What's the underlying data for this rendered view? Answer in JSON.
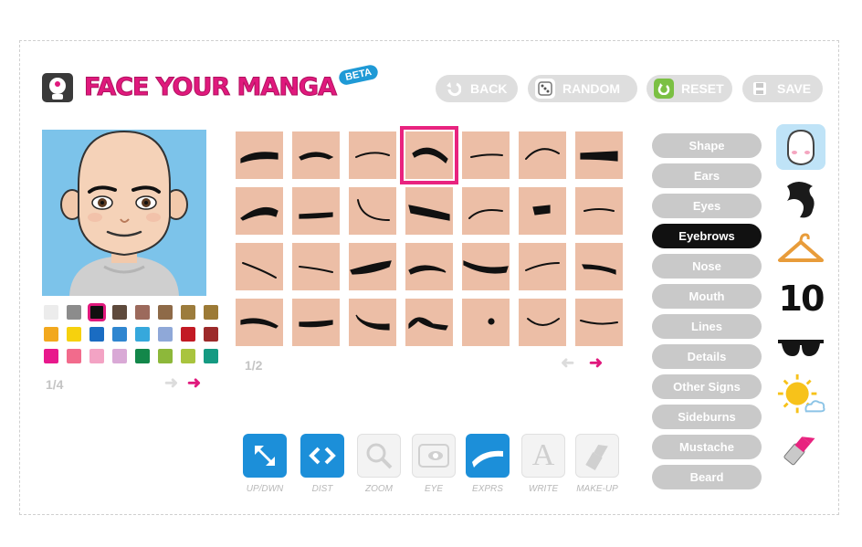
{
  "header": {
    "logo_text": "FACE YOUR MANGA",
    "beta_badge": "BETA",
    "buttons": [
      {
        "label": "BACK",
        "icon": "back-arrow-icon"
      },
      {
        "label": "RANDOM",
        "icon": "dice-icon"
      },
      {
        "label": "RESET",
        "icon": "reset-icon"
      },
      {
        "label": "SAVE",
        "icon": "disk-icon"
      }
    ]
  },
  "palette": {
    "colors": [
      "#ececec",
      "#8c8c8c",
      "#101010",
      "#5e4a3c",
      "#9c6a5c",
      "#8e6a48",
      "#9c7c3c",
      "#9c7a36",
      "#f2a81e",
      "#f6d10e",
      "#1a6cc2",
      "#2f86d0",
      "#36a8dc",
      "#8fa8d8",
      "#c21a24",
      "#9c2a2a",
      "#e8188c",
      "#f26b8c",
      "#f3a3c4",
      "#d9a9d6",
      "#13874a",
      "#8db83a",
      "#a9c43e",
      "#159a82"
    ],
    "selected_index": 2,
    "page": "1/4"
  },
  "grid": {
    "page": "1/2",
    "selected_index": 3
  },
  "categories": [
    {
      "label": "Shape"
    },
    {
      "label": "Ears"
    },
    {
      "label": "Eyes"
    },
    {
      "label": "Eyebrows"
    },
    {
      "label": "Nose"
    },
    {
      "label": "Mouth"
    },
    {
      "label": "Lines"
    },
    {
      "label": "Details"
    },
    {
      "label": "Other Signs"
    },
    {
      "label": "Sideburns"
    },
    {
      "label": "Mustache"
    },
    {
      "label": "Beard"
    }
  ],
  "selected_category": "Eyebrows",
  "side_icons": [
    "face-icon",
    "hair-icon",
    "hanger-icon",
    "number-ten-icon",
    "sunglasses-icon",
    "sun-icon",
    "lipstick-icon"
  ],
  "side_number": "10",
  "tools": [
    {
      "label": "UP/DWN",
      "active": true
    },
    {
      "label": "DIST",
      "active": true
    },
    {
      "label": "ZOOM",
      "active": false
    },
    {
      "label": "EYE",
      "active": false
    },
    {
      "label": "EXPRS",
      "active": true
    },
    {
      "label": "WRITE",
      "active": false
    },
    {
      "label": "MAKE-UP",
      "active": false
    }
  ],
  "colors": {
    "accent": "#e0197d",
    "blue": "#1c8fd9",
    "skin": "#ecbea6"
  }
}
